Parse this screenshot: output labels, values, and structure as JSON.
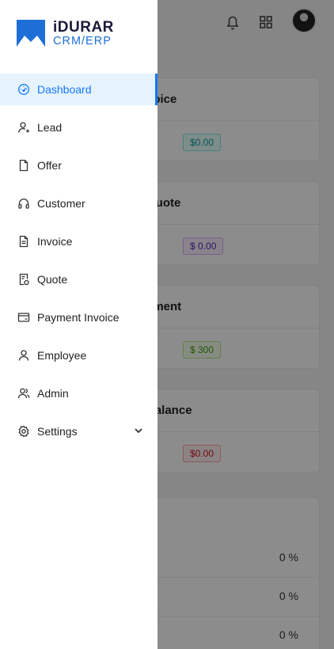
{
  "brand": {
    "line1": "iDURAR",
    "line2": "CRM/ERP",
    "accent": "#1677ff"
  },
  "menu": {
    "items": [
      {
        "label": "Dashboard",
        "icon": "dashboard-icon",
        "active": true
      },
      {
        "label": "Lead",
        "icon": "user-add-icon"
      },
      {
        "label": "Offer",
        "icon": "file-icon"
      },
      {
        "label": "Customer",
        "icon": "headset-icon"
      },
      {
        "label": "Invoice",
        "icon": "file-text-icon"
      },
      {
        "label": "Quote",
        "icon": "file-sync-icon"
      },
      {
        "label": "Payment Invoice",
        "icon": "credit-card-icon"
      },
      {
        "label": "Employee",
        "icon": "user-icon"
      },
      {
        "label": "Admin",
        "icon": "team-icon"
      },
      {
        "label": "Settings",
        "icon": "gear-icon",
        "expandable": true
      }
    ]
  },
  "cards": [
    {
      "title": "voice",
      "value": "$0.00"
    },
    {
      "title": "Quote",
      "value": "$ 0.00"
    },
    {
      "title": "yment",
      "value": "$ 300"
    },
    {
      "title": "Balance",
      "value": "$0.00"
    }
  ],
  "bottom": {
    "rows": [
      "0 %",
      "0 %",
      "0 %"
    ]
  }
}
